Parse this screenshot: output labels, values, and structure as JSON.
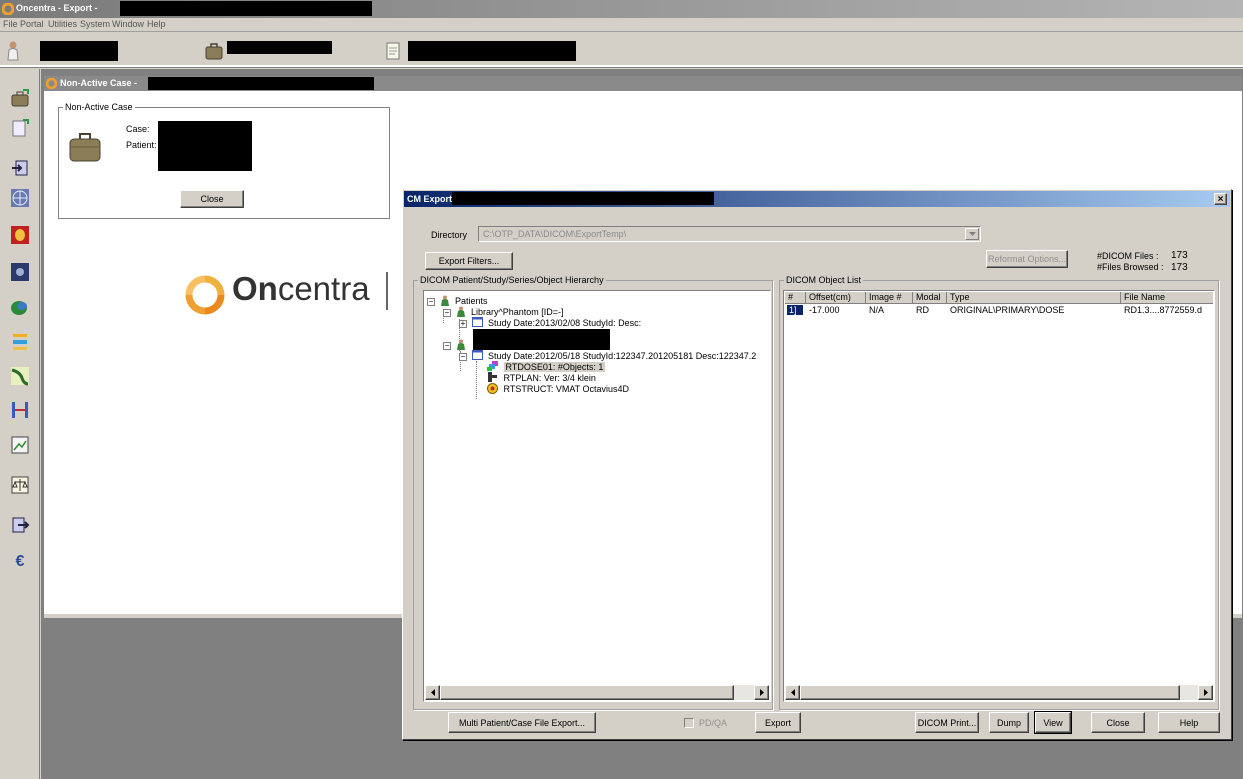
{
  "app": {
    "title": "Oncentra - Export -",
    "menu": [
      "File",
      "Portal",
      "Utilities",
      "System",
      "Window",
      "Help"
    ]
  },
  "inner_window": {
    "title": "Non-Active Case -",
    "group_label": "Non-Active Case",
    "case_label": "Case:",
    "patient_label": "Patient:",
    "close_label": "Close"
  },
  "logo": {
    "brand_bold": "On",
    "brand_rest": "centra"
  },
  "dialog": {
    "title": "CM Export [",
    "close_glyph": "×",
    "directory_label": "Directory",
    "directory_value": "C:\\OTP_DATA\\DICOM\\ExportTemp\\",
    "export_filters_label": "Export Filters...",
    "reformat_options_label": "Reformat Options...",
    "dicom_files_label": "#DICOM Files :",
    "dicom_files_value": "173",
    "files_browsed_label": "#Files Browsed :",
    "files_browsed_value": "173",
    "hierarchy_label": "DICOM Patient/Study/Series/Object Hierarchy",
    "object_list_label": "DICOM Object List",
    "tree": {
      "patients": "Patients",
      "library": "Library^Phantom [ID=-]",
      "study1": "Study Date:2013/02/08  StudyId:  Desc:",
      "study2": "Study Date:2012/05/18  StudyId:122347.201205181  Desc:122347.2",
      "rtdose": "RTDOSE01:  #Objects: 1",
      "rtplan": "RTPLAN: Ver: 3/4 klein",
      "rtstruct": "RTSTRUCT:  VMAT Octavius4D"
    },
    "columns": [
      "#",
      "Offset(cm)",
      "Image #",
      "Modal",
      "Type",
      "File Name"
    ],
    "rows": [
      {
        "num": "1]",
        "offset": "-17.000",
        "image": "N/A",
        "modal": "RD",
        "type": "ORIGINAL\\PRIMARY\\DOSE",
        "file": "RD1.3....8772559.d"
      }
    ],
    "multi_export_label": "Multi Patient/Case File Export...",
    "pdqa_label": "PD/QA",
    "export_label": "Export",
    "dicom_print_label": "DICOM Print...",
    "dump_label": "Dump",
    "view_label": "View",
    "close_label": "Close",
    "help_label": "Help"
  },
  "colors": {
    "titlebar_active": "#0a246a",
    "titlebar_gradient_end": "#a6caf0",
    "titlebar_inactive": "#808080",
    "desktop": "#808080",
    "logo_orange": "#f0a030"
  }
}
